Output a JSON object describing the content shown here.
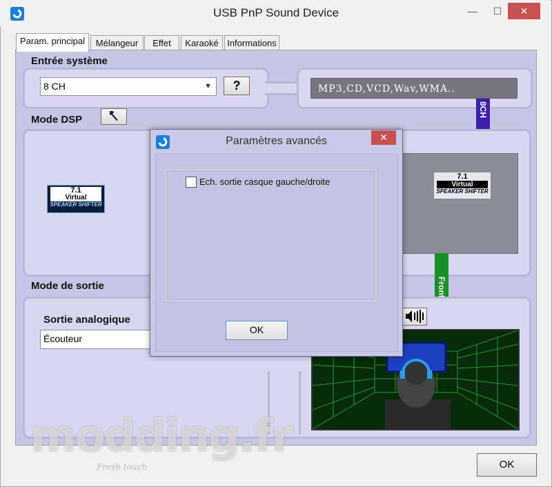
{
  "window": {
    "title": "USB PnP Sound Device",
    "min_glyph": "—",
    "max_glyph": "☐",
    "close_glyph": "✕"
  },
  "tabs": [
    {
      "label": "Param. principal",
      "active": true
    },
    {
      "label": "Mélangeur",
      "active": false
    },
    {
      "label": "Effet",
      "active": false
    },
    {
      "label": "Karaoké",
      "active": false
    },
    {
      "label": "Informations",
      "active": false
    }
  ],
  "input_system": {
    "label": "Entrée système",
    "value": "8 CH",
    "help_label": "?",
    "formats": "MP3,CD,VCD,Wav,WMA.."
  },
  "dsp": {
    "label": "Mode DSP",
    "logo_line1": "7.1",
    "logo_line2": "Virtual",
    "logo_line3": "SPEAKER SHIFTER"
  },
  "output": {
    "label": "Mode de sortie",
    "analog_label": "Sortie analogique",
    "analog_value": "Écouteur"
  },
  "signal_labels": {
    "top": "8CH",
    "front": "Front"
  },
  "dialog": {
    "title": "Paramètres avancés",
    "close_glyph": "✕",
    "checkbox_label": "Ech. sortie casque gauche/droite",
    "checkbox_checked": false,
    "ok_label": "OK"
  },
  "footer": {
    "ok_label": "OK"
  },
  "watermark": {
    "text": "modding.fr",
    "sub": "Fresh touch"
  },
  "colors": {
    "panel_bg": "#c7c6e4",
    "accent_red": "#c75050",
    "bar_blue": "#3b20a8",
    "bar_green": "#1c8f2a"
  }
}
